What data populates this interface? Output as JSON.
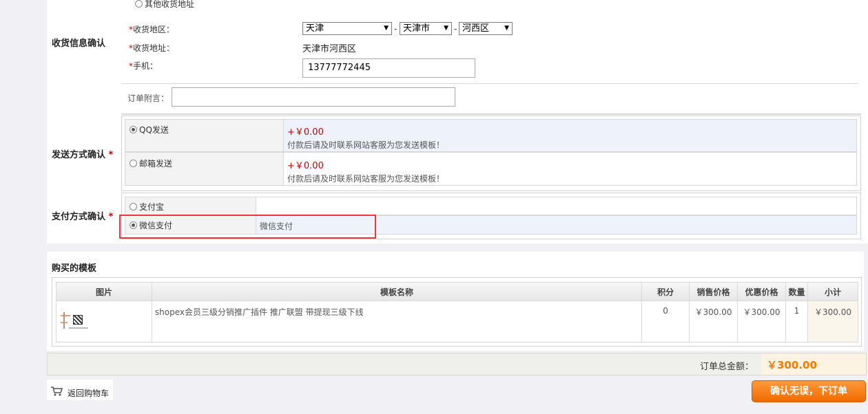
{
  "address": {
    "other_address_label": "其他收货地址",
    "section_title": "收货信息确认",
    "region_label": "收货地区：",
    "province": "天津",
    "city": "天津市",
    "district": "河西区",
    "sep": "-",
    "address_label": "收货地址：",
    "address_value": "天津市河西区",
    "phone_label": "手机：",
    "phone_value": "13777772445",
    "note_label": "订单附言：",
    "note_value": ""
  },
  "shipping": {
    "section_title": "发送方式确认",
    "options": [
      {
        "name": "QQ发送",
        "price": "+￥0.00",
        "desc": "付款后请及时联系网站客服为您发送模板！",
        "selected": true
      },
      {
        "name": "邮箱发送",
        "price": "+￥0.00",
        "desc": "付款后请及时联系网站客服为您发送模板！",
        "selected": false
      }
    ]
  },
  "payment": {
    "section_title": "支付方式确认",
    "options": [
      {
        "name": "支付宝",
        "desc": "",
        "selected": false
      },
      {
        "name": "微信支付",
        "desc": "微信支付",
        "selected": true
      }
    ]
  },
  "purchase": {
    "section_title": "购买的模板",
    "columns": [
      "图片",
      "模板名称",
      "积分",
      "销售价格",
      "优惠价格",
      "数量",
      "小计"
    ],
    "rows": [
      {
        "name": "shopex会员三级分销推广插件 推广联盟 带提现三级下线",
        "points": "0",
        "sale_price": "￥300.00",
        "discount_price": "￥300.00",
        "qty": "1",
        "subtotal": "￥300.00"
      }
    ]
  },
  "total": {
    "label": "订单总金额：",
    "value": "￥300.00"
  },
  "footer": {
    "back_to_cart": "返回购物车",
    "confirm_order": "确认无误，下订单"
  },
  "colors": {
    "accent_orange": "#f57c00",
    "price_red": "#cc0000",
    "highlight_red": "#e53935",
    "selected_row_bg": "#eef3fb"
  }
}
